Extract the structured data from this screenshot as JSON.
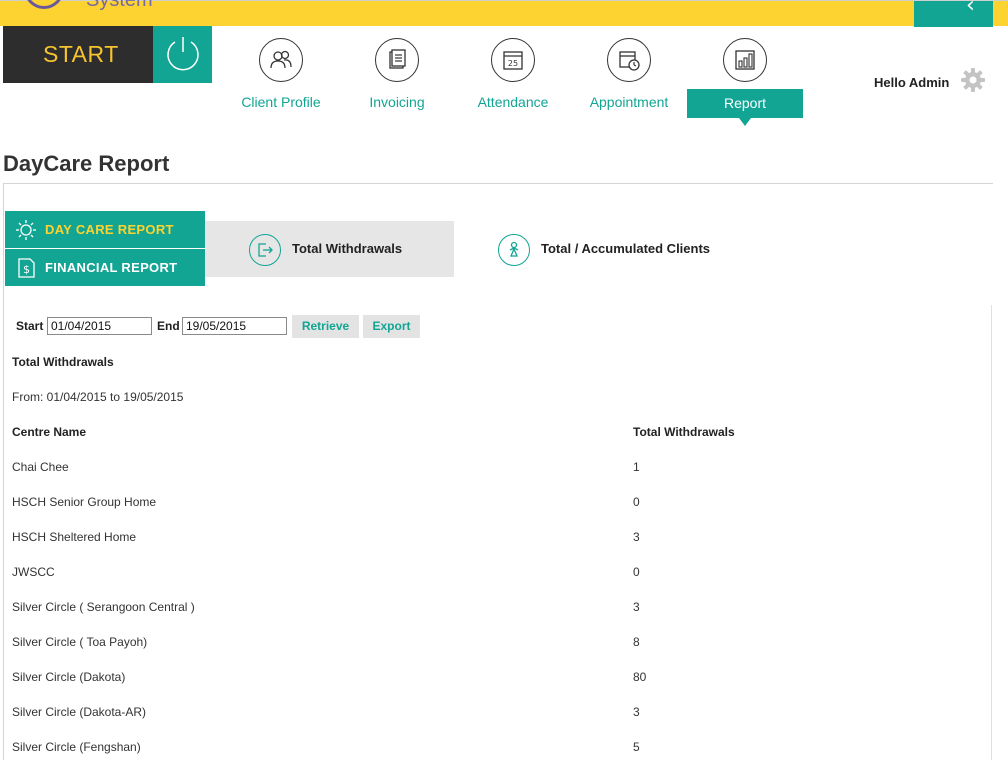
{
  "app": {
    "system_text": "System",
    "start_label": "START",
    "user_greeting": "Hello Admin"
  },
  "nav": [
    {
      "label": "Client Profile",
      "icon": "users-icon",
      "active": false
    },
    {
      "label": "Invoicing",
      "icon": "document-icon",
      "active": false
    },
    {
      "label": "Attendance",
      "icon": "calendar-icon",
      "active": false
    },
    {
      "label": "Appointment",
      "icon": "calendar-clock-icon",
      "active": false
    },
    {
      "label": "Report",
      "icon": "bar-chart-icon",
      "active": true
    }
  ],
  "page": {
    "title": "DayCare Report"
  },
  "side_menu": [
    {
      "label": "DAY CARE REPORT",
      "icon": "sun-icon",
      "active": true
    },
    {
      "label": "FINANCIAL REPORT",
      "icon": "dollar-document-icon",
      "active": false
    }
  ],
  "tabs": [
    {
      "label": "Total Withdrawals",
      "icon": "exit-icon",
      "active": true
    },
    {
      "label": "Total / Accumulated Clients",
      "icon": "person-icon",
      "active": false
    }
  ],
  "filter": {
    "start_label": "Start",
    "start_value": "01/04/2015",
    "end_label": "End",
    "end_value": "19/05/2015",
    "retrieve_label": "Retrieve",
    "export_label": "Export"
  },
  "report": {
    "heading": "Total Withdrawals",
    "range_text": "From: 01/04/2015 to 19/05/2015",
    "columns": [
      "Centre Name",
      "Total Withdrawals"
    ],
    "rows": [
      {
        "centre": "Chai Chee",
        "total": "1"
      },
      {
        "centre": "HSCH Senior Group Home",
        "total": "0"
      },
      {
        "centre": "HSCH Sheltered Home",
        "total": "3"
      },
      {
        "centre": "JWSCC",
        "total": "0"
      },
      {
        "centre": "Silver Circle ( Serangoon Central )",
        "total": "3"
      },
      {
        "centre": "Silver Circle ( Toa Payoh)",
        "total": "8"
      },
      {
        "centre": "Silver Circle (Dakota)",
        "total": "80"
      },
      {
        "centre": "Silver Circle (Dakota-AR)",
        "total": "3"
      },
      {
        "centre": "Silver Circle (Fengshan)",
        "total": "5"
      }
    ]
  },
  "colors": {
    "teal": "#12a594",
    "yellow": "#fcd330",
    "dark": "#2d2d2d"
  }
}
